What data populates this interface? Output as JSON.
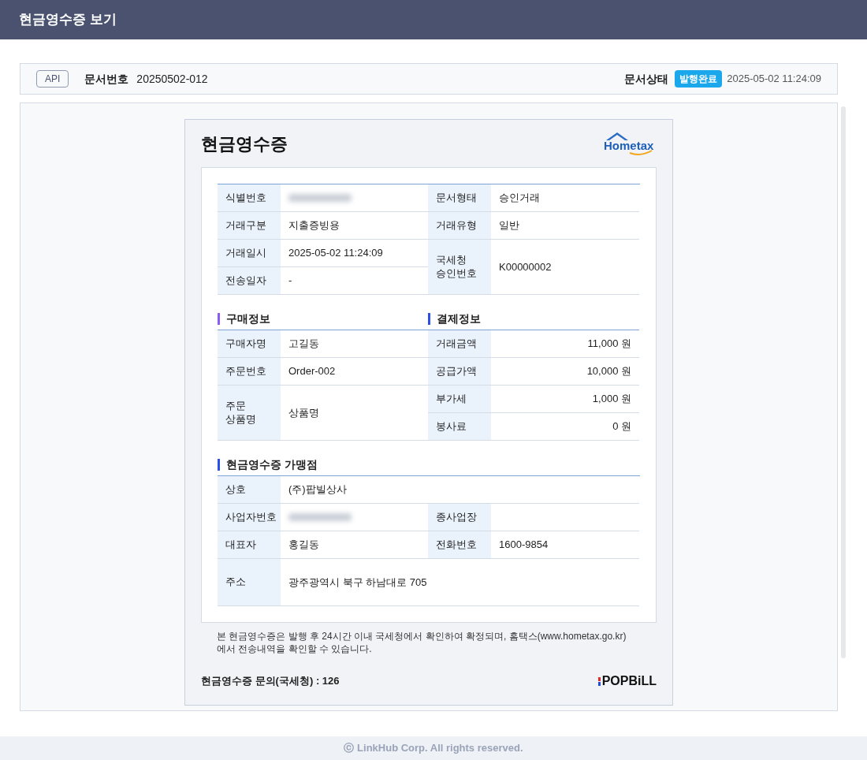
{
  "header": {
    "title": "현금영수증 보기"
  },
  "doc_bar": {
    "api_badge": "API",
    "doc_number_label": "문서번호",
    "doc_number": "20250502-012",
    "status_label": "문서상태",
    "status_badge": "발행완료",
    "status_time": "2025-05-02 11:24:09"
  },
  "receipt": {
    "title": "현금영수증",
    "logo_text": "Hometax",
    "basic": [
      {
        "label": "식별번호",
        "kind": "redacted"
      },
      {
        "label": "문서형태",
        "value": "승인거래",
        "kind": "text"
      },
      {
        "label": "거래구분",
        "value": "지출증빙용",
        "kind": "text"
      },
      {
        "label": "거래유형",
        "value": "일반",
        "kind": "text"
      },
      {
        "label": "거래일시",
        "value": "2025-05-02 11:24:09",
        "kind": "text"
      },
      {
        "label": "국세청 승인번호",
        "value": "K00000002",
        "kind": "text"
      },
      {
        "label": "전송일자",
        "value": "-",
        "kind": "text"
      }
    ],
    "purchase": {
      "heading": "구매정보",
      "color": "#8a5cf5",
      "rows": [
        {
          "label": "구매자명",
          "value": "고길동"
        },
        {
          "label": "주문번호",
          "value": "Order-002"
        },
        {
          "label": "주문 상품명",
          "value": "상품명"
        }
      ]
    },
    "payment": {
      "heading": "결제정보",
      "color": "#2b50e8",
      "rows": [
        {
          "label": "거래금액",
          "value": "11,000 원"
        },
        {
          "label": "공급가액",
          "value": "10,000 원"
        },
        {
          "label": "부가세",
          "value": "1,000 원"
        },
        {
          "label": "봉사료",
          "value": "0 원"
        }
      ]
    },
    "merchant": {
      "heading": "현금영수증 가맹점",
      "color": "#2b50e8",
      "rows": [
        [
          {
            "label": "상호",
            "value": "(주)팝빌상사",
            "kind": "text"
          }
        ],
        [
          {
            "label": "사업자번호",
            "kind": "redacted"
          },
          {
            "label": "종사업장",
            "kind": "text"
          }
        ],
        [
          {
            "label": "대표자",
            "value": "홍길동",
            "kind": "text"
          },
          {
            "label": "전화번호",
            "value": "1600-9854",
            "kind": "text"
          }
        ],
        [
          {
            "label": "주소",
            "value": "광주광역시 북구 하남대로 705",
            "kind": "text"
          }
        ]
      ]
    },
    "note": "본 현금영수증은 발행 후 24시간 이내 국세청에서 확인하여 확정되며, 홈택스(www.hometax.go.kr) 에서 전송내역을 확인할 수 있습니다.",
    "inquiry": "현금영수증 문의(국세청) : 126",
    "brand": "POPBiLL"
  },
  "footer": {
    "copyright": "ⓒ LinkHub Corp. All rights reserved."
  }
}
